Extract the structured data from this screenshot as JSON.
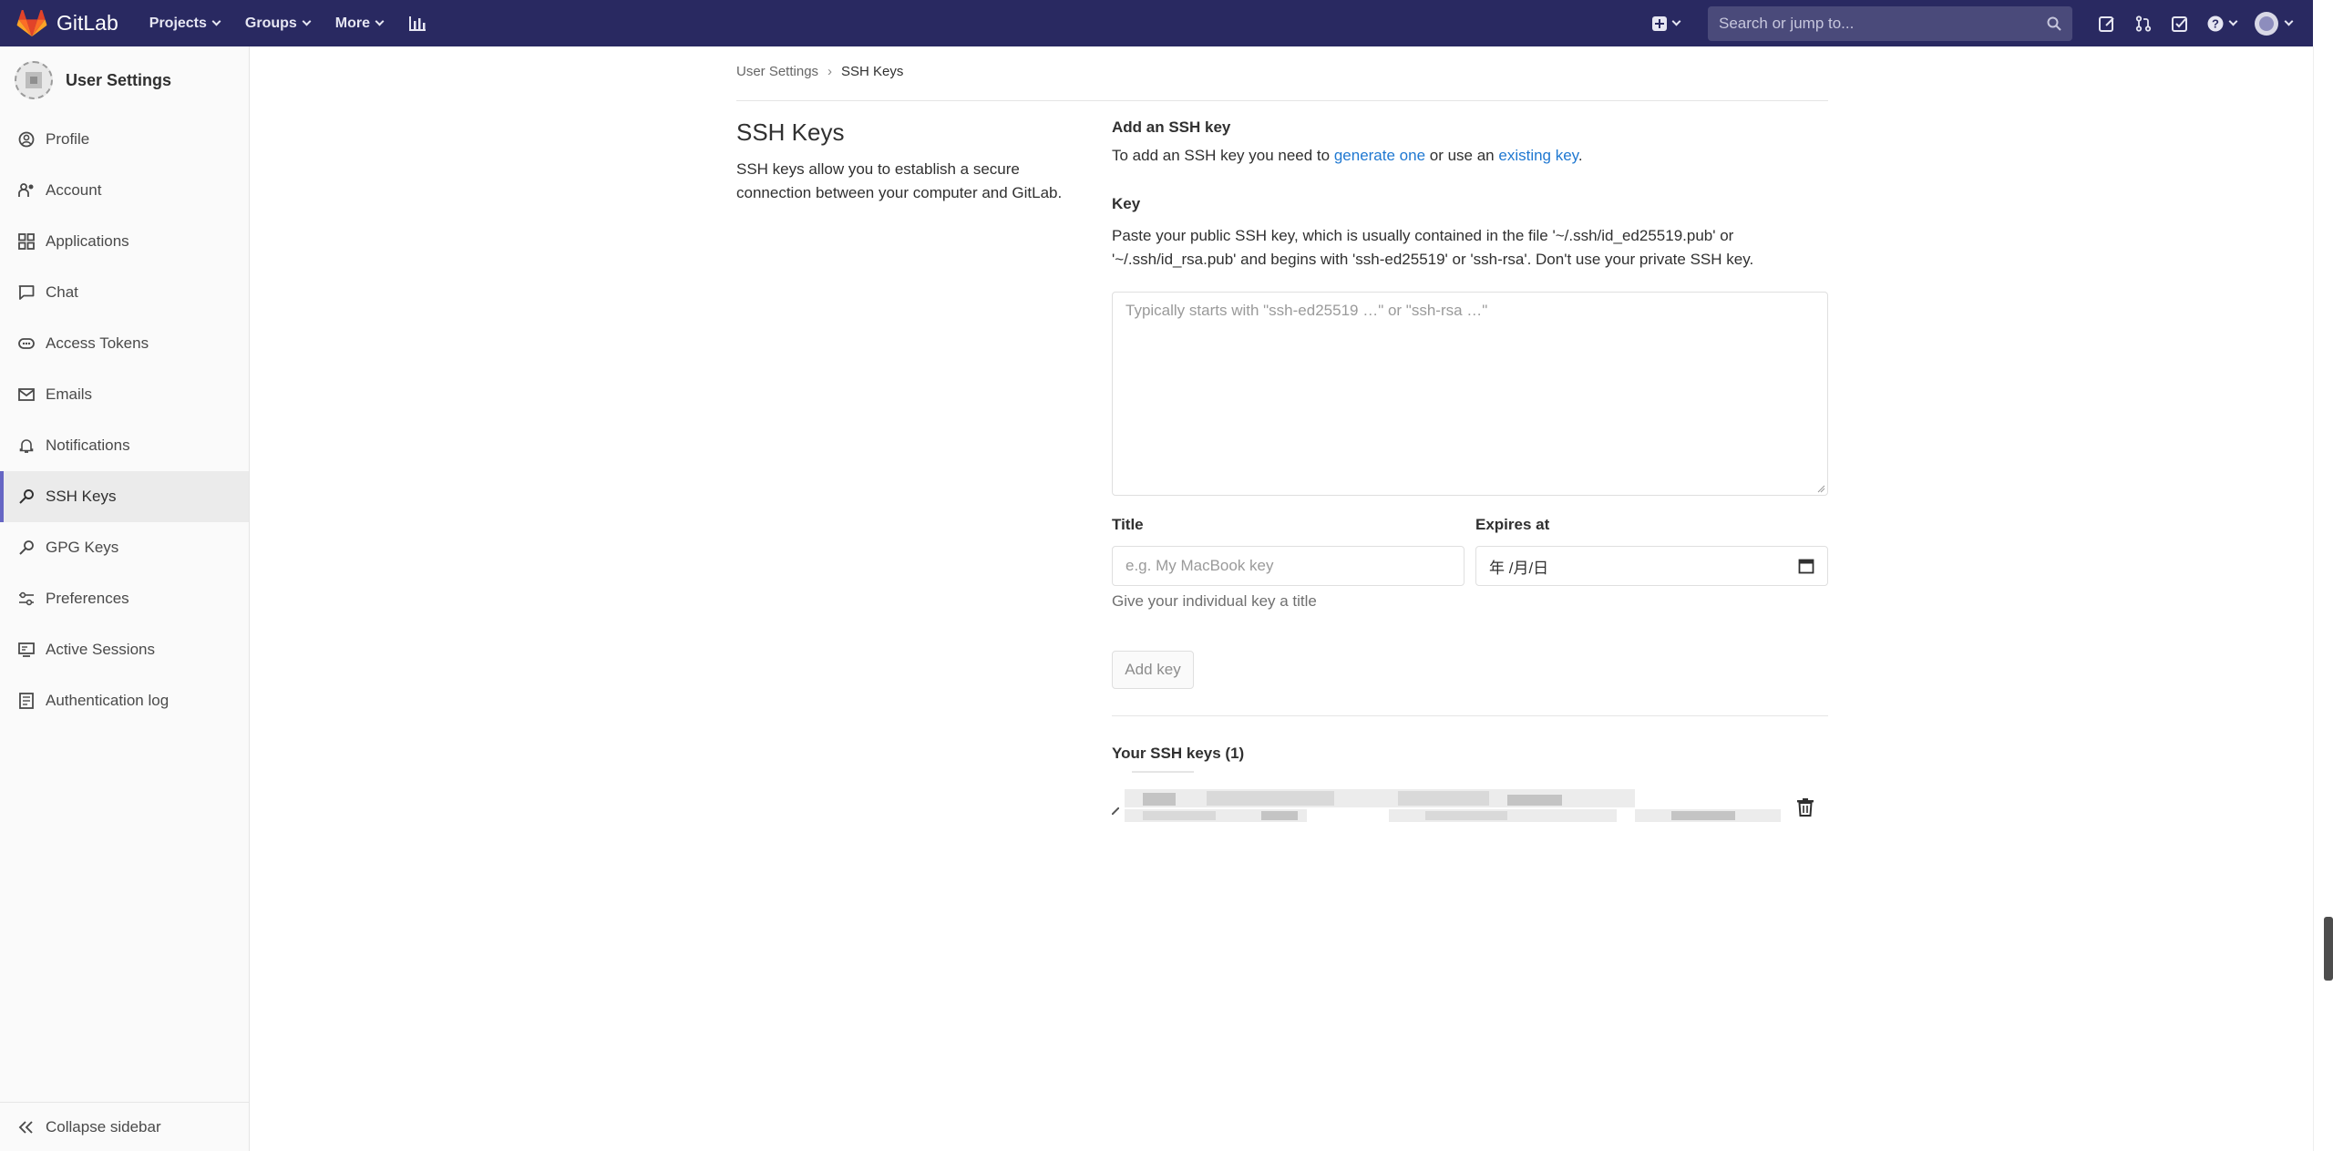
{
  "navbar": {
    "brand": "GitLab",
    "links": [
      "Projects",
      "Groups",
      "More"
    ],
    "search_placeholder": "Search or jump to...",
    "colors": {
      "bg": "#292961",
      "search_bg": "#4a4a7a"
    }
  },
  "sidebar": {
    "title": "User Settings",
    "items": [
      {
        "label": "Profile",
        "icon": "profile-icon"
      },
      {
        "label": "Account",
        "icon": "account-icon"
      },
      {
        "label": "Applications",
        "icon": "applications-icon"
      },
      {
        "label": "Chat",
        "icon": "chat-icon"
      },
      {
        "label": "Access Tokens",
        "icon": "token-icon"
      },
      {
        "label": "Emails",
        "icon": "mail-icon"
      },
      {
        "label": "Notifications",
        "icon": "bell-icon"
      },
      {
        "label": "SSH Keys",
        "icon": "key-icon",
        "active": true
      },
      {
        "label": "GPG Keys",
        "icon": "key-icon"
      },
      {
        "label": "Preferences",
        "icon": "preferences-icon"
      },
      {
        "label": "Active Sessions",
        "icon": "monitor-icon"
      },
      {
        "label": "Authentication log",
        "icon": "log-icon"
      }
    ],
    "collapse_label": "Collapse sidebar"
  },
  "breadcrumb": {
    "parent": "User Settings",
    "current": "SSH Keys"
  },
  "page": {
    "title": "SSH Keys",
    "description": "SSH keys allow you to establish a secure connection between your computer and GitLab."
  },
  "form": {
    "heading": "Add an SSH key",
    "intro_prefix": "To add an SSH key you need to ",
    "intro_link1": "generate one",
    "intro_middle": " or use an ",
    "intro_link2": "existing key",
    "intro_suffix": ".",
    "key_label": "Key",
    "key_help": "Paste your public SSH key, which is usually contained in the file '~/.ssh/id_ed25519.pub' or '~/.ssh/id_rsa.pub' and begins with 'ssh-ed25519' or 'ssh-rsa'. Don't use your private SSH key.",
    "key_placeholder": "Typically starts with \"ssh-ed25519 …\" or \"ssh-rsa …\"",
    "title_label": "Title",
    "title_placeholder": "e.g. My MacBook key",
    "title_hint": "Give your individual key a title",
    "expires_label": "Expires at",
    "expires_value": "年 /月/日",
    "submit_label": "Add key"
  },
  "keys_list": {
    "heading": "Your SSH keys (1)"
  }
}
